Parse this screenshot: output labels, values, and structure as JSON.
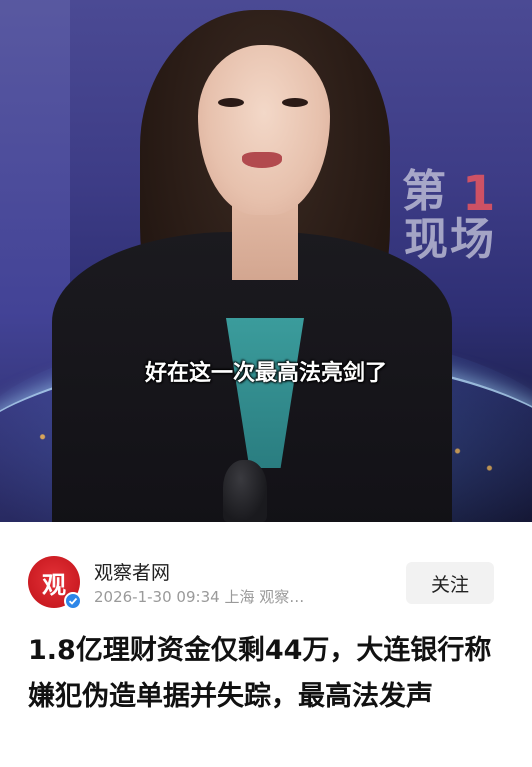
{
  "video": {
    "subtitle": "好在这一次最高法亮剑了",
    "logo_text_top": "第",
    "logo_text_bottom": "现场",
    "logo_number": "1"
  },
  "author": {
    "name": "观察者网",
    "avatar_glyph": "观",
    "date": "2026-1-30",
    "time": "09:34",
    "location": "上海",
    "source_truncated": "观察…"
  },
  "follow_button": "关注",
  "headline": "1.8亿理财资金仅剩44万，大连银行称嫌犯伪造单据并失踪，最高法发声",
  "colors": {
    "avatar_red": "#d42027",
    "verified_blue": "#2d86e8",
    "follow_bg": "#f2f2f2"
  }
}
